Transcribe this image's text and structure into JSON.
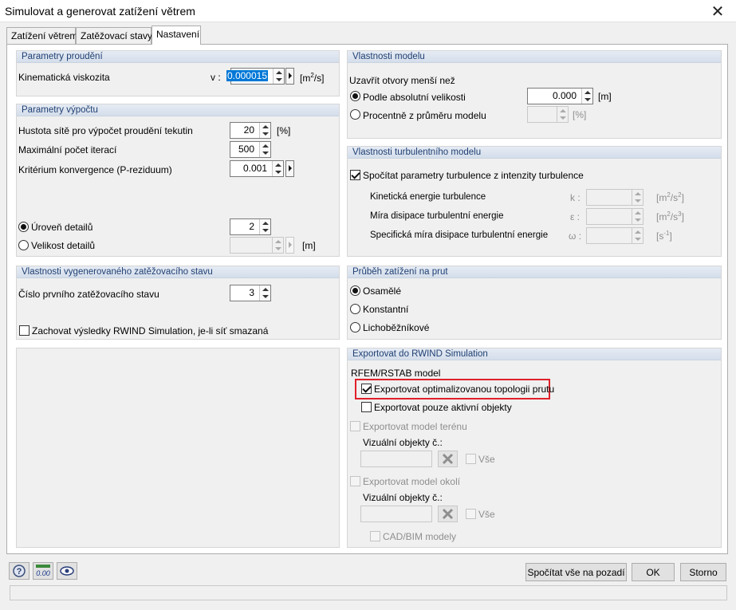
{
  "window": {
    "title": "Simulovat a generovat zatížení větrem",
    "close": "✕"
  },
  "tabs": [
    {
      "label": "Zatížení větrem"
    },
    {
      "label": "Zatěžovací stavy"
    },
    {
      "label": "Nastavení"
    }
  ],
  "flow": {
    "title": "Parametry proudění",
    "visc_label": "Kinematická viskozita",
    "symbol": "v :",
    "value": "0.000015",
    "unit_pre": "[m",
    "unit_sup": "2",
    "unit_post": "/s]"
  },
  "calc": {
    "title": "Parametry výpočtu",
    "mesh_label": "Hustota sítě pro výpočet proudění tekutin",
    "mesh_value": "20",
    "mesh_unit": "[%]",
    "iter_label": "Maximální počet iterací",
    "iter_value": "500",
    "conv_label": "Kritérium konvergence (P-reziduum)",
    "conv_value": "0.001",
    "detail_level_label": "Úroveň detailů",
    "detail_level_value": "2",
    "detail_size_label": "Velikost detailů",
    "detail_size_value": "",
    "detail_size_unit": "[m]"
  },
  "lc": {
    "title": "Vlastnosti vygenerovaného zatěžovacího stavu",
    "first_label": "Číslo prvního zatěžovacího stavu",
    "first_value": "3",
    "keep_label": "Zachovat výsledky RWIND Simulation, je-li síť smazaná"
  },
  "model": {
    "title": "Vlastnosti modelu",
    "close_label": "Uzavřít otvory menší než",
    "abs_label": "Podle absolutní velikosti",
    "abs_value": "0.000",
    "abs_unit": "[m]",
    "pct_label": "Procentně z průměru modelu",
    "pct_value": "",
    "pct_unit": "[%]"
  },
  "turb": {
    "title": "Vlastnosti turbulentního modelu",
    "calc_label": "Spočítat parametry turbulence z intenzity turbulence",
    "k_label": "Kinetická energie turbulence",
    "k_sym": "k :",
    "k_unit_pre": "[m",
    "k_unit_sup": "2",
    "k_unit_mid": "/s",
    "k_unit_sup2": "2",
    "k_unit_post": "]",
    "eps_label": "Míra disipace turbulentní energie",
    "eps_sym": "ε :",
    "eps_unit_pre": "[m",
    "eps_unit_sup": "2",
    "eps_unit_mid": "/s",
    "eps_unit_sup2": "3",
    "eps_unit_post": "]",
    "omega_label": "Specifická míra disipace turbulentní energie",
    "omega_sym": "ω :",
    "omega_unit_pre": "[s",
    "omega_unit_sup": "-1",
    "omega_unit_post": "]"
  },
  "member": {
    "title": "Průběh zatížení na prut",
    "opt1": "Osamělé",
    "opt2": "Konstantní",
    "opt3": "Lichoběžníkové"
  },
  "export": {
    "title": "Exportovat do RWIND Simulation",
    "model_label": "RFEM/RSTAB model",
    "opt_topology": "Exportovat optimalizovanou topologii prutu",
    "active_only": "Exportovat pouze aktivní objekty",
    "terrain": "Exportovat model terénu",
    "vis_objects": "Vizuální objekty č.:",
    "all": "Vše",
    "surroundings": "Exportovat model okolí",
    "vis_objects2": "Vizuální objekty č.:",
    "all2": "Vše",
    "cadbim": "CAD/BIM modely",
    "highlight_color": "#e0202a"
  },
  "footer": {
    "calc_bg": "Spočítat vše na pozadí",
    "ok": "OK",
    "cancel": "Storno",
    "icons": [
      "help-icon",
      "units-icon",
      "view-icon"
    ]
  }
}
